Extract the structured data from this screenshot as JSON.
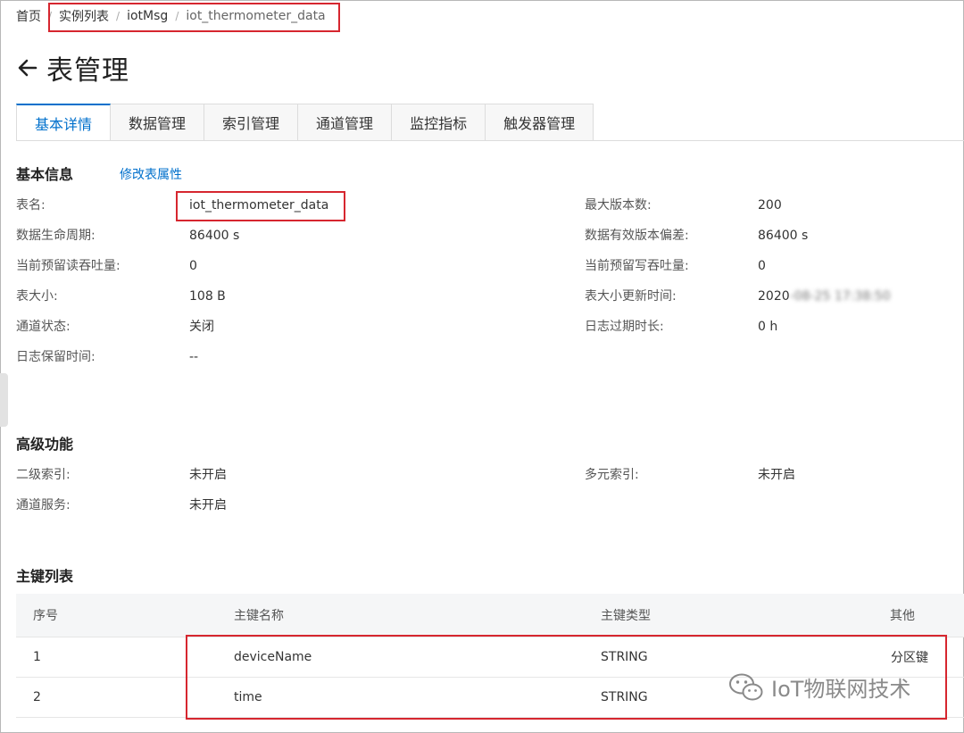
{
  "breadcrumb": {
    "items": [
      "首页",
      "实例列表",
      "iotMsg",
      "iot_thermometer_data"
    ]
  },
  "page": {
    "title": "表管理"
  },
  "tabs": [
    "基本详情",
    "数据管理",
    "索引管理",
    "通道管理",
    "监控指标",
    "触发器管理"
  ],
  "basic_info": {
    "title": "基本信息",
    "edit_link": "修改表属性",
    "left": [
      {
        "label": "表名:",
        "value": "iot_thermometer_data"
      },
      {
        "label": "数据生命周期:",
        "value": "86400 s"
      },
      {
        "label": "当前预留读吞吐量:",
        "value": "0"
      },
      {
        "label": "表大小:",
        "value": "108 B"
      },
      {
        "label": "通道状态:",
        "value": "关闭"
      },
      {
        "label": "日志保留时间:",
        "value": "--"
      }
    ],
    "right": [
      {
        "label": "最大版本数:",
        "value": "200"
      },
      {
        "label": "数据有效版本偏差:",
        "value": "86400 s"
      },
      {
        "label": "当前预留写吞吐量:",
        "value": "0"
      },
      {
        "label": "表大小更新时间:",
        "value": "2020",
        "value_blurred": "-08-25 17:38:50"
      },
      {
        "label": "日志过期时长:",
        "value": "0 h"
      }
    ]
  },
  "advanced": {
    "title": "高级功能",
    "left": [
      {
        "label": "二级索引:",
        "value": "未开启"
      },
      {
        "label": "通道服务:",
        "value": "未开启"
      }
    ],
    "right": [
      {
        "label": "多元索引:",
        "value": "未开启"
      }
    ]
  },
  "primary_keys": {
    "title": "主键列表",
    "columns": [
      "序号",
      "主键名称",
      "主键类型",
      "其他"
    ],
    "rows": [
      {
        "index": "1",
        "name": "deviceName",
        "type": "STRING",
        "other": "分区键"
      },
      {
        "index": "2",
        "name": "time",
        "type": "STRING",
        "other": ""
      }
    ]
  },
  "watermark": {
    "text": "IoT物联网技术"
  },
  "colors": {
    "accent": "#0070cc",
    "highlight_border": "#d6262f"
  }
}
